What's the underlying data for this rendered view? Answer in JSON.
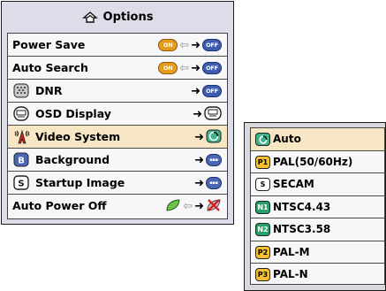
{
  "options": {
    "title": "Options",
    "header_icon": "options-icon",
    "rows": [
      {
        "label": "Power Save",
        "icon": null,
        "from_state": "ON",
        "to_state": "OFF"
      },
      {
        "label": "Auto Search",
        "icon": null,
        "from_state": "ON",
        "to_state": "OFF"
      },
      {
        "label": "DNR",
        "icon": "dnr-icon",
        "to_state": "OFF"
      },
      {
        "label": "OSD Display",
        "icon": "osd-display-icon",
        "to_state": "osd-display-icon"
      },
      {
        "label": "Video System",
        "icon": "video-system-icon",
        "to_state": "auto-icon",
        "selected": true
      },
      {
        "label": "Background",
        "icon": "background-icon",
        "badge": "B",
        "to_state": "background-icon"
      },
      {
        "label": "Startup Image",
        "icon": "startup-image-icon",
        "badge": "S",
        "to_state": "startup-image-icon"
      },
      {
        "label": "Auto Power Off",
        "icon": null,
        "from_state": "leaf-icon",
        "to_state": "power-off-x-icon"
      }
    ]
  },
  "video_system": {
    "items": [
      {
        "label": "Auto",
        "badge": "",
        "badge_icon": "auto-icon",
        "selected": true
      },
      {
        "label": "PAL(50/60Hz)",
        "badge": "P1"
      },
      {
        "label": "SECAM",
        "badge": "S"
      },
      {
        "label": "NTSC4.43",
        "badge": "N1"
      },
      {
        "label": "NTSC3.58",
        "badge": "N2"
      },
      {
        "label": "PAL-M",
        "badge": "P2"
      },
      {
        "label": "PAL-N",
        "badge": "P3"
      }
    ]
  },
  "colors": {
    "panel_bg": "#dcdde8",
    "list_bg": "#f7f7fa",
    "selected_bg": "#f6e6c4",
    "on_pill": "#e79b1d",
    "off_pill": "#3f5db0",
    "badge_yellow": "#f2c030",
    "badge_green": "#27a06a"
  }
}
